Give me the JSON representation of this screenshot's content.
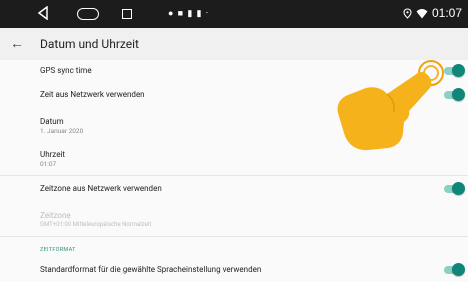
{
  "status": {
    "time": "01:07"
  },
  "appbar": {
    "title": "Datum und Uhrzeit"
  },
  "settings": {
    "gps_sync": {
      "label": "GPS sync time"
    },
    "network_time": {
      "label": "Zeit aus Netzwerk verwenden"
    },
    "date": {
      "label": "Datum",
      "value": "1. Januar 2020"
    },
    "time": {
      "label": "Uhrzeit",
      "value": "01:07"
    },
    "network_timezone": {
      "label": "Zeitzone aus Netzwerk verwenden"
    },
    "timezone": {
      "label": "Zeitzone",
      "value": "GMT+01:00 Mitteleuropäische Normalzeit"
    },
    "format_header": "ZEITFORMAT",
    "locale_format": {
      "label": "Standardformat für die gewählte Spracheinstellung verwenden"
    }
  },
  "colors": {
    "accent": "#10857a",
    "pointer": "#f6b21a"
  }
}
